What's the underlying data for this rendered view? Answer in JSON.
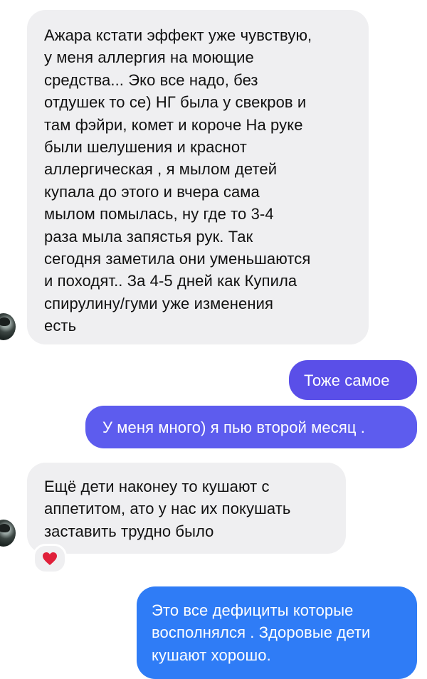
{
  "messages": [
    {
      "id": "msg1",
      "direction": "incoming",
      "lines": [
        "Ажара кстати эффект уже чувствую,",
        "у меня аллергия на моющие",
        "средства... Эко все надо, без",
        "отдушек то се) НГ была  у свекров и",
        "там фэйри, комет и короче На руке",
        "были шелушения и краснот",
        "аллергическая , я мылом детей",
        "купала до этого  и вчера сама",
        "мылом помылась, ну где то 3-4",
        "раза мыла запястья рук. Так",
        "сегодня заметила они уменьшаются",
        "и походят.. За 4-5 дней как Купила",
        "спирулину/гуми уже изменения",
        "есть"
      ]
    },
    {
      "id": "msg2",
      "direction": "outgoing",
      "lines": [
        "Тоже самое"
      ]
    },
    {
      "id": "msg3",
      "direction": "outgoing",
      "lines": [
        "У меня много) я пью второй месяц ."
      ]
    },
    {
      "id": "msg4",
      "direction": "incoming",
      "lines": [
        "Ещё дети наконеу то кушают с",
        "аппетитом, ато у нас их покушать",
        "заставить трудно было"
      ],
      "reaction": "heart"
    },
    {
      "id": "msg5",
      "direction": "outgoing",
      "lines": [
        "Это все дефициты которые",
        "восполнялся . Здоровые дети",
        "кушают хорошо."
      ]
    }
  ],
  "colors": {
    "incoming_bubble": "#efeff1",
    "outgoing_purple": "#5a4fe8",
    "outgoing_violet": "#5d5cee",
    "outgoing_blue": "#2f7cf6",
    "heart": "#e0203a"
  },
  "icons": {
    "reaction": "heart-icon",
    "avatar": "contact-avatar"
  }
}
